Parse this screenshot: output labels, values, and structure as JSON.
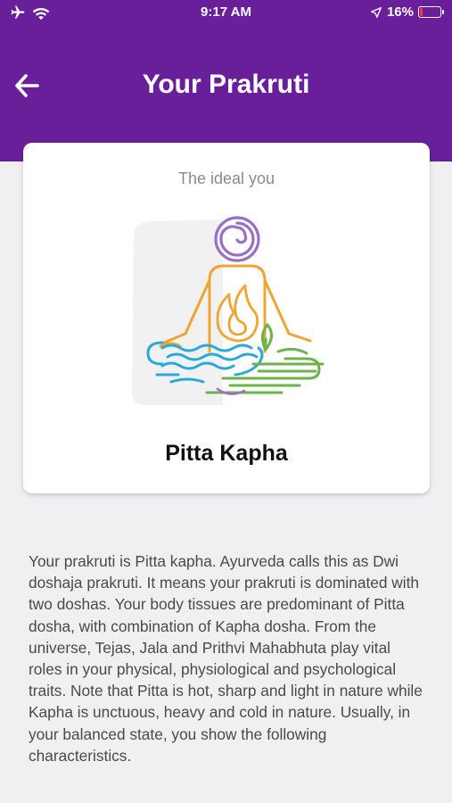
{
  "status_bar": {
    "time": "9:17 AM",
    "battery_percent": "16%",
    "battery_level": 0.16
  },
  "header": {
    "title": "Your Prakruti"
  },
  "card": {
    "subtitle": "The ideal you",
    "dosha_name": "Pitta Kapha"
  },
  "description": "Your prakruti is Pitta kapha. Ayurveda calls this as Dwi doshaja prakruti. It means your prakruti is dominated with two doshas. Your body tissues are predominant of Pitta dosha, with combination of Kapha dosha. From the universe, Tejas, Jala and Prithvi Mahabhuta play vital roles in your physical, physiological and psychological traits. Note that Pitta is hot, sharp and light in nature while Kapha is unctuous, heavy and cold in nature. Usually, in your balanced state, you show the following characteristics.",
  "colors": {
    "header": "#6a1f9a",
    "background": "#f0eff2",
    "battery_low": "#ff3b30",
    "spiral": "#9b6fc4",
    "pitta": "#f0a431",
    "water": "#2aa8d8",
    "earth": "#6db34a"
  }
}
